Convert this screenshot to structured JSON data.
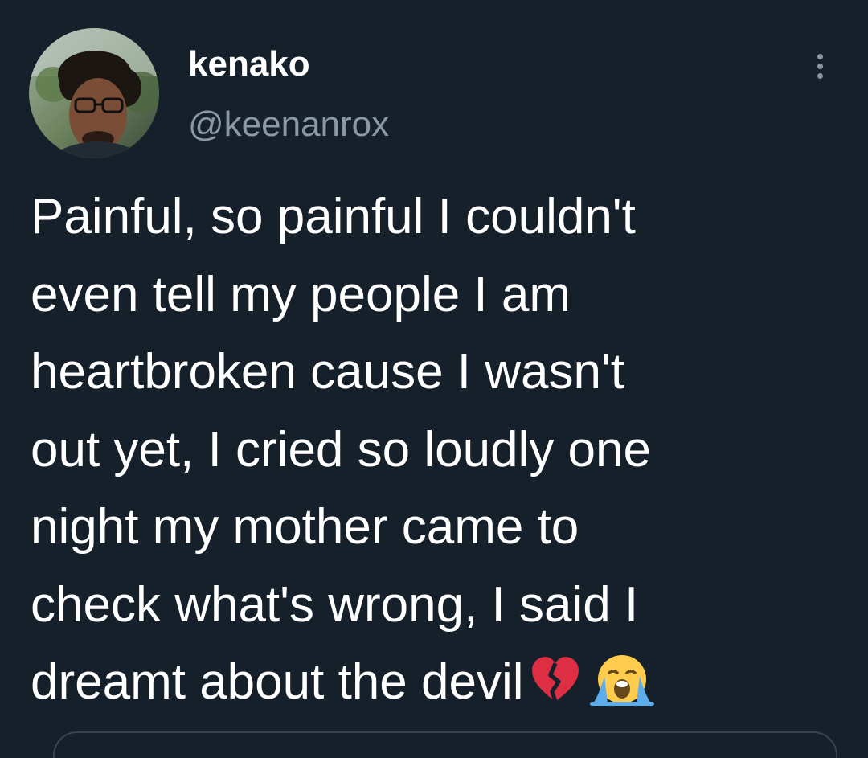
{
  "user": {
    "display_name": "kenako",
    "handle": "@keenanrox",
    "avatar_icon": "profile-photo"
  },
  "more_icon": "ellipsis-vertical-icon",
  "tweet": {
    "text": "Painful, so painful I couldn't\neven tell my people I am\nheartbroken cause I wasn't\nout yet, I cried so loudly one\nnight my mother came to\ncheck what's wrong, I said I\ndreamt about the devil",
    "emojis": [
      "broken-heart-emoji",
      "loudly-crying-face-emoji"
    ]
  },
  "colors": {
    "background": "#15202b",
    "text": "#ffffff",
    "secondary_text": "#8b98a5",
    "border": "#38444d"
  }
}
